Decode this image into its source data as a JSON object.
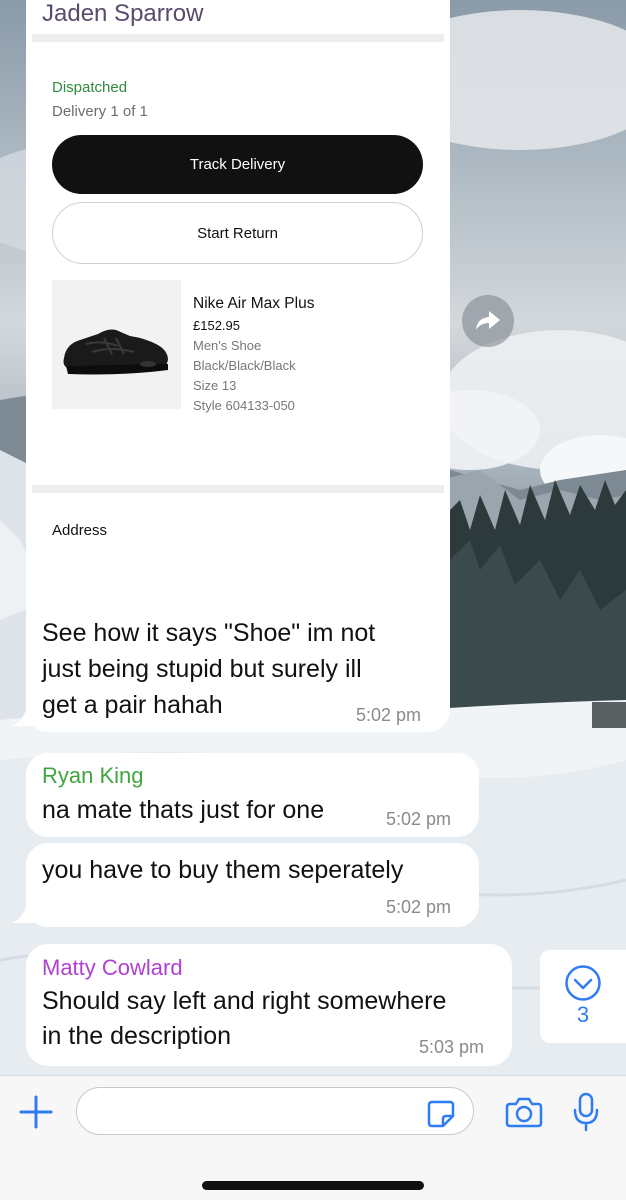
{
  "order_card": {
    "sender": "Jaden Sparrow",
    "status": "Dispatched",
    "delivery_count": "Delivery 1 of 1",
    "track_button_label": "Track Delivery",
    "return_button_label": "Start Return",
    "product": {
      "name": "Nike Air Max Plus",
      "price": "£152.95",
      "category": "Men's Shoe",
      "color": "Black/Black/Black",
      "size": "Size 13",
      "style": "Style 604133-050"
    },
    "address_label": "Address"
  },
  "messages": [
    {
      "sender": "",
      "lines": [
        "See how it says \"Shoe\" im not",
        "just being stupid but surely ill",
        "get a pair hahah"
      ],
      "time": "5:02 pm"
    },
    {
      "sender": "Ryan King",
      "lines": [
        "na mate thats just for one"
      ],
      "time": "5:02 pm"
    },
    {
      "sender": "",
      "lines": [
        "you have to buy them seperately"
      ],
      "time": "5:02 pm"
    },
    {
      "sender": "Matty Cowlard",
      "lines": [
        "Should say left and right somewhere",
        "in the description"
      ],
      "time": "5:03 pm"
    }
  ],
  "scroll_badge": {
    "unread_count": "3"
  },
  "input_bar": {
    "message_value": "",
    "placeholder": ""
  },
  "colors": {
    "sender_ryan": "#3fa63f",
    "sender_matty": "#b23fd1",
    "dispatched_green": "#2f8c3f",
    "accent_blue": "#2f7cf6"
  },
  "icons": {
    "attach": "plus-icon",
    "sticker": "sticker-icon",
    "camera": "camera-icon",
    "microphone": "microphone-icon",
    "forward": "forward-arrow-icon",
    "scroll_down": "chevron-down-circle-icon"
  }
}
